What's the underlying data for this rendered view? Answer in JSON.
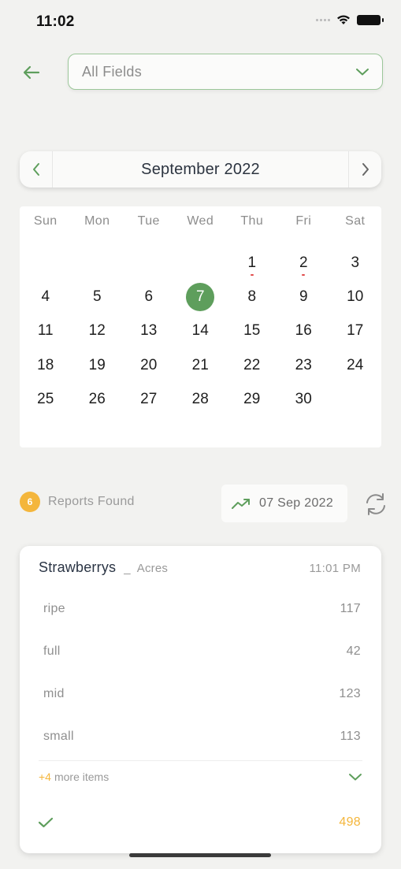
{
  "status_bar": {
    "time": "11:02"
  },
  "header": {
    "field_select_value": "All Fields"
  },
  "calendar": {
    "month_title": "September 2022",
    "weekdays": [
      "Sun",
      "Mon",
      "Tue",
      "Wed",
      "Thu",
      "Fri",
      "Sat"
    ],
    "leading_blanks": 4,
    "days": [
      "1",
      "2",
      "3",
      "4",
      "5",
      "6",
      "7",
      "8",
      "9",
      "10",
      "11",
      "12",
      "13",
      "14",
      "15",
      "16",
      "17",
      "18",
      "19",
      "20",
      "21",
      "22",
      "23",
      "24",
      "25",
      "26",
      "27",
      "28",
      "29",
      "30"
    ],
    "selected_day": "7",
    "marked_days": [
      "1",
      "2"
    ],
    "accent_color": "#5e9e5c"
  },
  "reports": {
    "count": "6",
    "label": "Reports Found",
    "date": "07 Sep 2022"
  },
  "report_card": {
    "crop": "Strawberrys",
    "acres_label": "Acres",
    "acres_value": "_",
    "time": "11:01 PM",
    "items": [
      {
        "label": "ripe",
        "value": "117"
      },
      {
        "label": "full",
        "value": "42"
      },
      {
        "label": "mid",
        "value": "123"
      },
      {
        "label": "small",
        "value": "113"
      }
    ],
    "more_count": "+4",
    "more_label": "more items",
    "total": "498"
  },
  "colors": {
    "accent_green": "#5e9e5c",
    "accent_orange": "#f4b63c"
  }
}
